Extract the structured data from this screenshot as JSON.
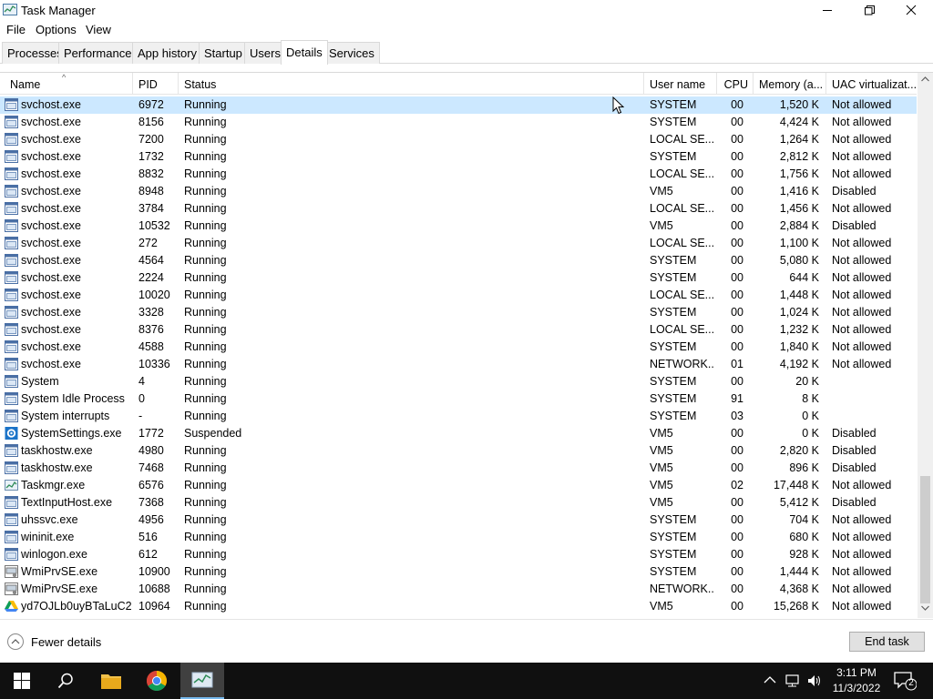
{
  "window": {
    "title": "Task Manager"
  },
  "menu": {
    "items": [
      "File",
      "Options",
      "View"
    ]
  },
  "tabs": [
    "Processes",
    "Performance",
    "App history",
    "Startup",
    "Users",
    "Details",
    "Services"
  ],
  "active_tab": "Details",
  "columns": {
    "name": "Name",
    "pid": "PID",
    "status": "Status",
    "user": "User name",
    "cpu": "CPU",
    "memory": "Memory (a...",
    "uac": "UAC virtualizat..."
  },
  "processes": [
    {
      "name": "svchost.exe",
      "pid": "6972",
      "status": "Running",
      "user": "SYSTEM",
      "cpu": "00",
      "mem": "1,520 K",
      "uac": "Not allowed",
      "icon": "service-icon"
    },
    {
      "name": "svchost.exe",
      "pid": "8156",
      "status": "Running",
      "user": "SYSTEM",
      "cpu": "00",
      "mem": "4,424 K",
      "uac": "Not allowed",
      "icon": "service-icon"
    },
    {
      "name": "svchost.exe",
      "pid": "7200",
      "status": "Running",
      "user": "LOCAL SE...",
      "cpu": "00",
      "mem": "1,264 K",
      "uac": "Not allowed",
      "icon": "service-icon"
    },
    {
      "name": "svchost.exe",
      "pid": "1732",
      "status": "Running",
      "user": "SYSTEM",
      "cpu": "00",
      "mem": "2,812 K",
      "uac": "Not allowed",
      "icon": "service-icon"
    },
    {
      "name": "svchost.exe",
      "pid": "8832",
      "status": "Running",
      "user": "LOCAL SE...",
      "cpu": "00",
      "mem": "1,756 K",
      "uac": "Not allowed",
      "icon": "service-icon"
    },
    {
      "name": "svchost.exe",
      "pid": "8948",
      "status": "Running",
      "user": "VM5",
      "cpu": "00",
      "mem": "1,416 K",
      "uac": "Disabled",
      "icon": "service-icon"
    },
    {
      "name": "svchost.exe",
      "pid": "3784",
      "status": "Running",
      "user": "LOCAL SE...",
      "cpu": "00",
      "mem": "1,456 K",
      "uac": "Not allowed",
      "icon": "service-icon"
    },
    {
      "name": "svchost.exe",
      "pid": "10532",
      "status": "Running",
      "user": "VM5",
      "cpu": "00",
      "mem": "2,884 K",
      "uac": "Disabled",
      "icon": "service-icon"
    },
    {
      "name": "svchost.exe",
      "pid": "272",
      "status": "Running",
      "user": "LOCAL SE...",
      "cpu": "00",
      "mem": "1,100 K",
      "uac": "Not allowed",
      "icon": "service-icon"
    },
    {
      "name": "svchost.exe",
      "pid": "4564",
      "status": "Running",
      "user": "SYSTEM",
      "cpu": "00",
      "mem": "5,080 K",
      "uac": "Not allowed",
      "icon": "service-icon"
    },
    {
      "name": "svchost.exe",
      "pid": "2224",
      "status": "Running",
      "user": "SYSTEM",
      "cpu": "00",
      "mem": "644 K",
      "uac": "Not allowed",
      "icon": "service-icon"
    },
    {
      "name": "svchost.exe",
      "pid": "10020",
      "status": "Running",
      "user": "LOCAL SE...",
      "cpu": "00",
      "mem": "1,448 K",
      "uac": "Not allowed",
      "icon": "service-icon"
    },
    {
      "name": "svchost.exe",
      "pid": "3328",
      "status": "Running",
      "user": "SYSTEM",
      "cpu": "00",
      "mem": "1,024 K",
      "uac": "Not allowed",
      "icon": "service-icon"
    },
    {
      "name": "svchost.exe",
      "pid": "8376",
      "status": "Running",
      "user": "LOCAL SE...",
      "cpu": "00",
      "mem": "1,232 K",
      "uac": "Not allowed",
      "icon": "service-icon"
    },
    {
      "name": "svchost.exe",
      "pid": "4588",
      "status": "Running",
      "user": "SYSTEM",
      "cpu": "00",
      "mem": "1,840 K",
      "uac": "Not allowed",
      "icon": "service-icon"
    },
    {
      "name": "svchost.exe",
      "pid": "10336",
      "status": "Running",
      "user": "NETWORK...",
      "cpu": "01",
      "mem": "4,192 K",
      "uac": "Not allowed",
      "icon": "service-icon"
    },
    {
      "name": "System",
      "pid": "4",
      "status": "Running",
      "user": "SYSTEM",
      "cpu": "00",
      "mem": "20 K",
      "uac": "",
      "icon": "process-icon"
    },
    {
      "name": "System Idle Process",
      "pid": "0",
      "status": "Running",
      "user": "SYSTEM",
      "cpu": "91",
      "mem": "8 K",
      "uac": "",
      "icon": "process-icon"
    },
    {
      "name": "System interrupts",
      "pid": "-",
      "status": "Running",
      "user": "SYSTEM",
      "cpu": "03",
      "mem": "0 K",
      "uac": "",
      "icon": "process-icon"
    },
    {
      "name": "SystemSettings.exe",
      "pid": "1772",
      "status": "Suspended",
      "user": "VM5",
      "cpu": "00",
      "mem": "0 K",
      "uac": "Disabled",
      "icon": "gear-icon"
    },
    {
      "name": "taskhostw.exe",
      "pid": "4980",
      "status": "Running",
      "user": "VM5",
      "cpu": "00",
      "mem": "2,820 K",
      "uac": "Disabled",
      "icon": "process-icon"
    },
    {
      "name": "taskhostw.exe",
      "pid": "7468",
      "status": "Running",
      "user": "VM5",
      "cpu": "00",
      "mem": "896 K",
      "uac": "Disabled",
      "icon": "process-icon"
    },
    {
      "name": "Taskmgr.exe",
      "pid": "6576",
      "status": "Running",
      "user": "VM5",
      "cpu": "02",
      "mem": "17,448 K",
      "uac": "Not allowed",
      "icon": "taskmgr-icon"
    },
    {
      "name": "TextInputHost.exe",
      "pid": "7368",
      "status": "Running",
      "user": "VM5",
      "cpu": "00",
      "mem": "5,412 K",
      "uac": "Disabled",
      "icon": "process-icon"
    },
    {
      "name": "uhssvc.exe",
      "pid": "4956",
      "status": "Running",
      "user": "SYSTEM",
      "cpu": "00",
      "mem": "704 K",
      "uac": "Not allowed",
      "icon": "process-icon"
    },
    {
      "name": "wininit.exe",
      "pid": "516",
      "status": "Running",
      "user": "SYSTEM",
      "cpu": "00",
      "mem": "680 K",
      "uac": "Not allowed",
      "icon": "process-icon"
    },
    {
      "name": "winlogon.exe",
      "pid": "612",
      "status": "Running",
      "user": "SYSTEM",
      "cpu": "00",
      "mem": "928 K",
      "uac": "Not allowed",
      "icon": "process-icon"
    },
    {
      "name": "WmiPrvSE.exe",
      "pid": "10900",
      "status": "Running",
      "user": "SYSTEM",
      "cpu": "00",
      "mem": "1,444 K",
      "uac": "Not allowed",
      "icon": "wmi-icon"
    },
    {
      "name": "WmiPrvSE.exe",
      "pid": "10688",
      "status": "Running",
      "user": "NETWORK...",
      "cpu": "00",
      "mem": "4,368 K",
      "uac": "Not allowed",
      "icon": "wmi-icon"
    },
    {
      "name": "yd7OJLb0uyBTaLuC2...",
      "pid": "10964",
      "status": "Running",
      "user": "VM5",
      "cpu": "00",
      "mem": "15,268 K",
      "uac": "Not allowed",
      "icon": "drive-icon"
    }
  ],
  "footer": {
    "fewer_details": "Fewer details",
    "end_task": "End task"
  },
  "taskbar": {
    "time": "3:11 PM",
    "date": "11/3/2022",
    "notifications": "2"
  },
  "colors": {
    "selection": "#cce8ff",
    "taskbar": "#101010",
    "accent": "#76b9ed"
  }
}
